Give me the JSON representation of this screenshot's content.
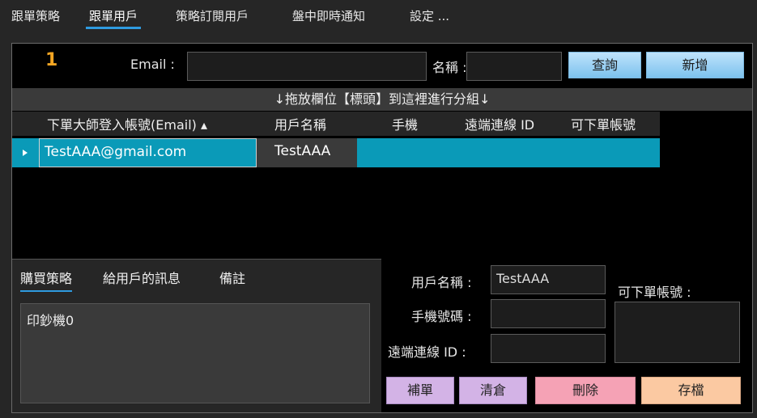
{
  "tabs": [
    {
      "label": "跟單策略"
    },
    {
      "label": "跟單用戶"
    },
    {
      "label": "策略訂閱用戶"
    },
    {
      "label": "盤中即時通知"
    },
    {
      "label": "設定 ..."
    }
  ],
  "search": {
    "row_number": "1",
    "email_label": "Email :",
    "email_value": "",
    "name_label": "名稱 :",
    "name_value": "",
    "query_button": "查詢",
    "add_button": "新增"
  },
  "grid": {
    "group_header": "↓拖放欄位【標頭】到這裡進行分組↓",
    "columns": [
      "下單大師登入帳號(Email) ▴",
      "用戶名稱",
      "手機",
      "遠端連線 ID",
      "可下單帳號"
    ],
    "rows": [
      {
        "email": "TestAAA@gmail.com",
        "name": "TestAAA",
        "phone": "",
        "remote_id": "",
        "accounts": ""
      }
    ]
  },
  "bottom_tabs": [
    {
      "label": "購買策略"
    },
    {
      "label": "給用戶的訊息"
    },
    {
      "label": "備註"
    }
  ],
  "purchased_strategy": "印鈔機0",
  "detail": {
    "name_label": "用戶名稱 :",
    "name_value": "TestAAA",
    "phone_label": "手機號碼 :",
    "phone_value": "",
    "remote_label": "遠端連線 ID :",
    "remote_value": "",
    "accounts_label": "可下單帳號 :",
    "accounts_value": ""
  },
  "actions": {
    "backfill": "補單",
    "liquidate": "清倉",
    "delete": "刪除",
    "save": "存檔"
  },
  "colors": {
    "accent": "#2f9be0",
    "selected_row": "#0a9ab8",
    "row_number": "#f5a623",
    "btn_purple": "#d3b3e6",
    "btn_pink": "#f5a2b5",
    "btn_orange": "#fbc9a2"
  }
}
